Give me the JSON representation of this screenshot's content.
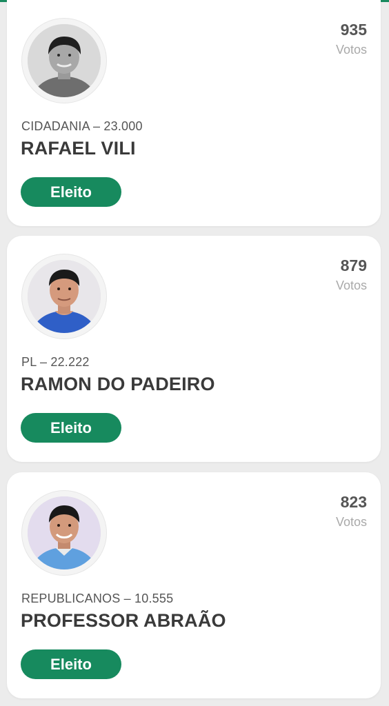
{
  "colors": {
    "accent": "#178a5e",
    "card_bg": "#ffffff",
    "page_bg": "#ececec",
    "name_text": "#3a3a3a",
    "muted_text": "#a9a9a9"
  },
  "candidates": [
    {
      "votes": "935",
      "votes_label": "Votos",
      "party": "CIDADANIA – 23.000",
      "name": "RAFAEL VILI",
      "status": "Eleito",
      "photo": "candidate-photo-grayscale"
    },
    {
      "votes": "879",
      "votes_label": "Votos",
      "party": "PL – 22.222",
      "name": "RAMON DO PADEIRO",
      "status": "Eleito",
      "photo": "candidate-photo-color"
    },
    {
      "votes": "823",
      "votes_label": "Votos",
      "party": "REPUBLICANOS – 10.555",
      "name": "PROFESSOR ABRAÃO",
      "status": "Eleito",
      "photo": "candidate-photo-color"
    }
  ]
}
